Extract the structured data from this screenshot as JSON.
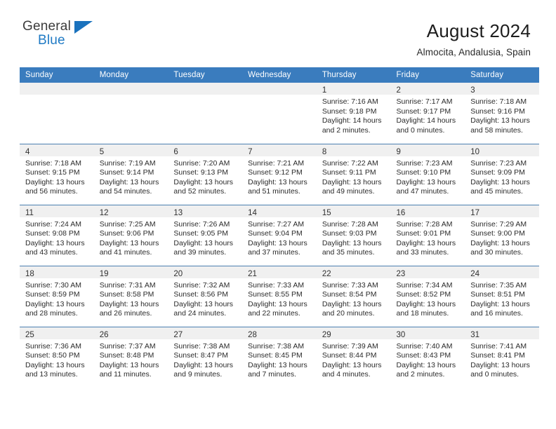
{
  "brand": {
    "name_part1": "General",
    "name_part2": "Blue",
    "triangle_color": "#1a72bd",
    "blue_text_color": "#1f7ac4"
  },
  "header": {
    "title": "August 2024",
    "subtitle": "Almocita, Andalusia, Spain",
    "header_bg_color": "#3a7cbe",
    "header_text_color": "#ffffff"
  },
  "calendar": {
    "weekday_headers": [
      "Sunday",
      "Monday",
      "Tuesday",
      "Wednesday",
      "Thursday",
      "Friday",
      "Saturday"
    ],
    "weeks": [
      [
        {
          "day": "",
          "lines": []
        },
        {
          "day": "",
          "lines": []
        },
        {
          "day": "",
          "lines": []
        },
        {
          "day": "",
          "lines": []
        },
        {
          "day": "1",
          "lines": [
            "Sunrise: 7:16 AM",
            "Sunset: 9:18 PM",
            "Daylight: 14 hours",
            "and 2 minutes."
          ]
        },
        {
          "day": "2",
          "lines": [
            "Sunrise: 7:17 AM",
            "Sunset: 9:17 PM",
            "Daylight: 14 hours",
            "and 0 minutes."
          ]
        },
        {
          "day": "3",
          "lines": [
            "Sunrise: 7:18 AM",
            "Sunset: 9:16 PM",
            "Daylight: 13 hours",
            "and 58 minutes."
          ]
        }
      ],
      [
        {
          "day": "4",
          "lines": [
            "Sunrise: 7:18 AM",
            "Sunset: 9:15 PM",
            "Daylight: 13 hours",
            "and 56 minutes."
          ]
        },
        {
          "day": "5",
          "lines": [
            "Sunrise: 7:19 AM",
            "Sunset: 9:14 PM",
            "Daylight: 13 hours",
            "and 54 minutes."
          ]
        },
        {
          "day": "6",
          "lines": [
            "Sunrise: 7:20 AM",
            "Sunset: 9:13 PM",
            "Daylight: 13 hours",
            "and 52 minutes."
          ]
        },
        {
          "day": "7",
          "lines": [
            "Sunrise: 7:21 AM",
            "Sunset: 9:12 PM",
            "Daylight: 13 hours",
            "and 51 minutes."
          ]
        },
        {
          "day": "8",
          "lines": [
            "Sunrise: 7:22 AM",
            "Sunset: 9:11 PM",
            "Daylight: 13 hours",
            "and 49 minutes."
          ]
        },
        {
          "day": "9",
          "lines": [
            "Sunrise: 7:23 AM",
            "Sunset: 9:10 PM",
            "Daylight: 13 hours",
            "and 47 minutes."
          ]
        },
        {
          "day": "10",
          "lines": [
            "Sunrise: 7:23 AM",
            "Sunset: 9:09 PM",
            "Daylight: 13 hours",
            "and 45 minutes."
          ]
        }
      ],
      [
        {
          "day": "11",
          "lines": [
            "Sunrise: 7:24 AM",
            "Sunset: 9:08 PM",
            "Daylight: 13 hours",
            "and 43 minutes."
          ]
        },
        {
          "day": "12",
          "lines": [
            "Sunrise: 7:25 AM",
            "Sunset: 9:06 PM",
            "Daylight: 13 hours",
            "and 41 minutes."
          ]
        },
        {
          "day": "13",
          "lines": [
            "Sunrise: 7:26 AM",
            "Sunset: 9:05 PM",
            "Daylight: 13 hours",
            "and 39 minutes."
          ]
        },
        {
          "day": "14",
          "lines": [
            "Sunrise: 7:27 AM",
            "Sunset: 9:04 PM",
            "Daylight: 13 hours",
            "and 37 minutes."
          ]
        },
        {
          "day": "15",
          "lines": [
            "Sunrise: 7:28 AM",
            "Sunset: 9:03 PM",
            "Daylight: 13 hours",
            "and 35 minutes."
          ]
        },
        {
          "day": "16",
          "lines": [
            "Sunrise: 7:28 AM",
            "Sunset: 9:01 PM",
            "Daylight: 13 hours",
            "and 33 minutes."
          ]
        },
        {
          "day": "17",
          "lines": [
            "Sunrise: 7:29 AM",
            "Sunset: 9:00 PM",
            "Daylight: 13 hours",
            "and 30 minutes."
          ]
        }
      ],
      [
        {
          "day": "18",
          "lines": [
            "Sunrise: 7:30 AM",
            "Sunset: 8:59 PM",
            "Daylight: 13 hours",
            "and 28 minutes."
          ]
        },
        {
          "day": "19",
          "lines": [
            "Sunrise: 7:31 AM",
            "Sunset: 8:58 PM",
            "Daylight: 13 hours",
            "and 26 minutes."
          ]
        },
        {
          "day": "20",
          "lines": [
            "Sunrise: 7:32 AM",
            "Sunset: 8:56 PM",
            "Daylight: 13 hours",
            "and 24 minutes."
          ]
        },
        {
          "day": "21",
          "lines": [
            "Sunrise: 7:33 AM",
            "Sunset: 8:55 PM",
            "Daylight: 13 hours",
            "and 22 minutes."
          ]
        },
        {
          "day": "22",
          "lines": [
            "Sunrise: 7:33 AM",
            "Sunset: 8:54 PM",
            "Daylight: 13 hours",
            "and 20 minutes."
          ]
        },
        {
          "day": "23",
          "lines": [
            "Sunrise: 7:34 AM",
            "Sunset: 8:52 PM",
            "Daylight: 13 hours",
            "and 18 minutes."
          ]
        },
        {
          "day": "24",
          "lines": [
            "Sunrise: 7:35 AM",
            "Sunset: 8:51 PM",
            "Daylight: 13 hours",
            "and 16 minutes."
          ]
        }
      ],
      [
        {
          "day": "25",
          "lines": [
            "Sunrise: 7:36 AM",
            "Sunset: 8:50 PM",
            "Daylight: 13 hours",
            "and 13 minutes."
          ]
        },
        {
          "day": "26",
          "lines": [
            "Sunrise: 7:37 AM",
            "Sunset: 8:48 PM",
            "Daylight: 13 hours",
            "and 11 minutes."
          ]
        },
        {
          "day": "27",
          "lines": [
            "Sunrise: 7:38 AM",
            "Sunset: 8:47 PM",
            "Daylight: 13 hours",
            "and 9 minutes."
          ]
        },
        {
          "day": "28",
          "lines": [
            "Sunrise: 7:38 AM",
            "Sunset: 8:45 PM",
            "Daylight: 13 hours",
            "and 7 minutes."
          ]
        },
        {
          "day": "29",
          "lines": [
            "Sunrise: 7:39 AM",
            "Sunset: 8:44 PM",
            "Daylight: 13 hours",
            "and 4 minutes."
          ]
        },
        {
          "day": "30",
          "lines": [
            "Sunrise: 7:40 AM",
            "Sunset: 8:43 PM",
            "Daylight: 13 hours",
            "and 2 minutes."
          ]
        },
        {
          "day": "31",
          "lines": [
            "Sunrise: 7:41 AM",
            "Sunset: 8:41 PM",
            "Daylight: 13 hours",
            "and 0 minutes."
          ]
        }
      ]
    ]
  }
}
